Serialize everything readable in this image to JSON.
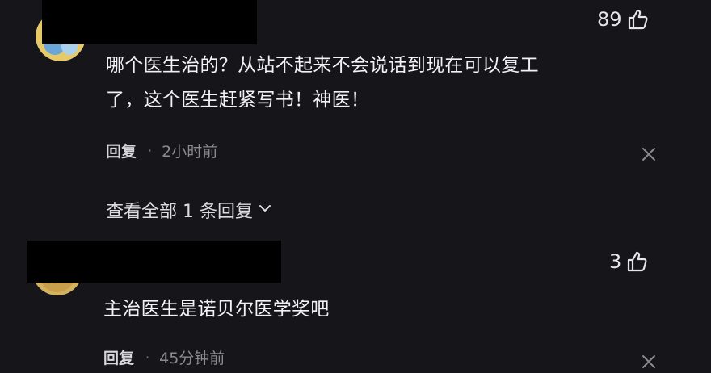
{
  "comments": [
    {
      "likes": "89",
      "text_lines": [
        "哪个医生治的？从站不起来不会说话到现在可以复工",
        "了，这个医生赶紧写书！神医！"
      ],
      "reply_label": "回复",
      "separator": "·",
      "time": "2小时前",
      "view_replies_label": "查看全部 1 条回复"
    },
    {
      "likes": "3",
      "text_lines": [
        "主治医生是诺贝尔医学奖吧"
      ],
      "reply_label": "回复",
      "separator": "·",
      "time": "45分钟前"
    }
  ],
  "icons": {
    "like": "thumbs-up-icon",
    "close": "close-icon",
    "expand": "chevron-down-icon"
  },
  "colors": {
    "background": "#16161a",
    "primary_text": "#f2f2f4",
    "secondary_text": "#8a8a90",
    "redaction": "#000000"
  }
}
